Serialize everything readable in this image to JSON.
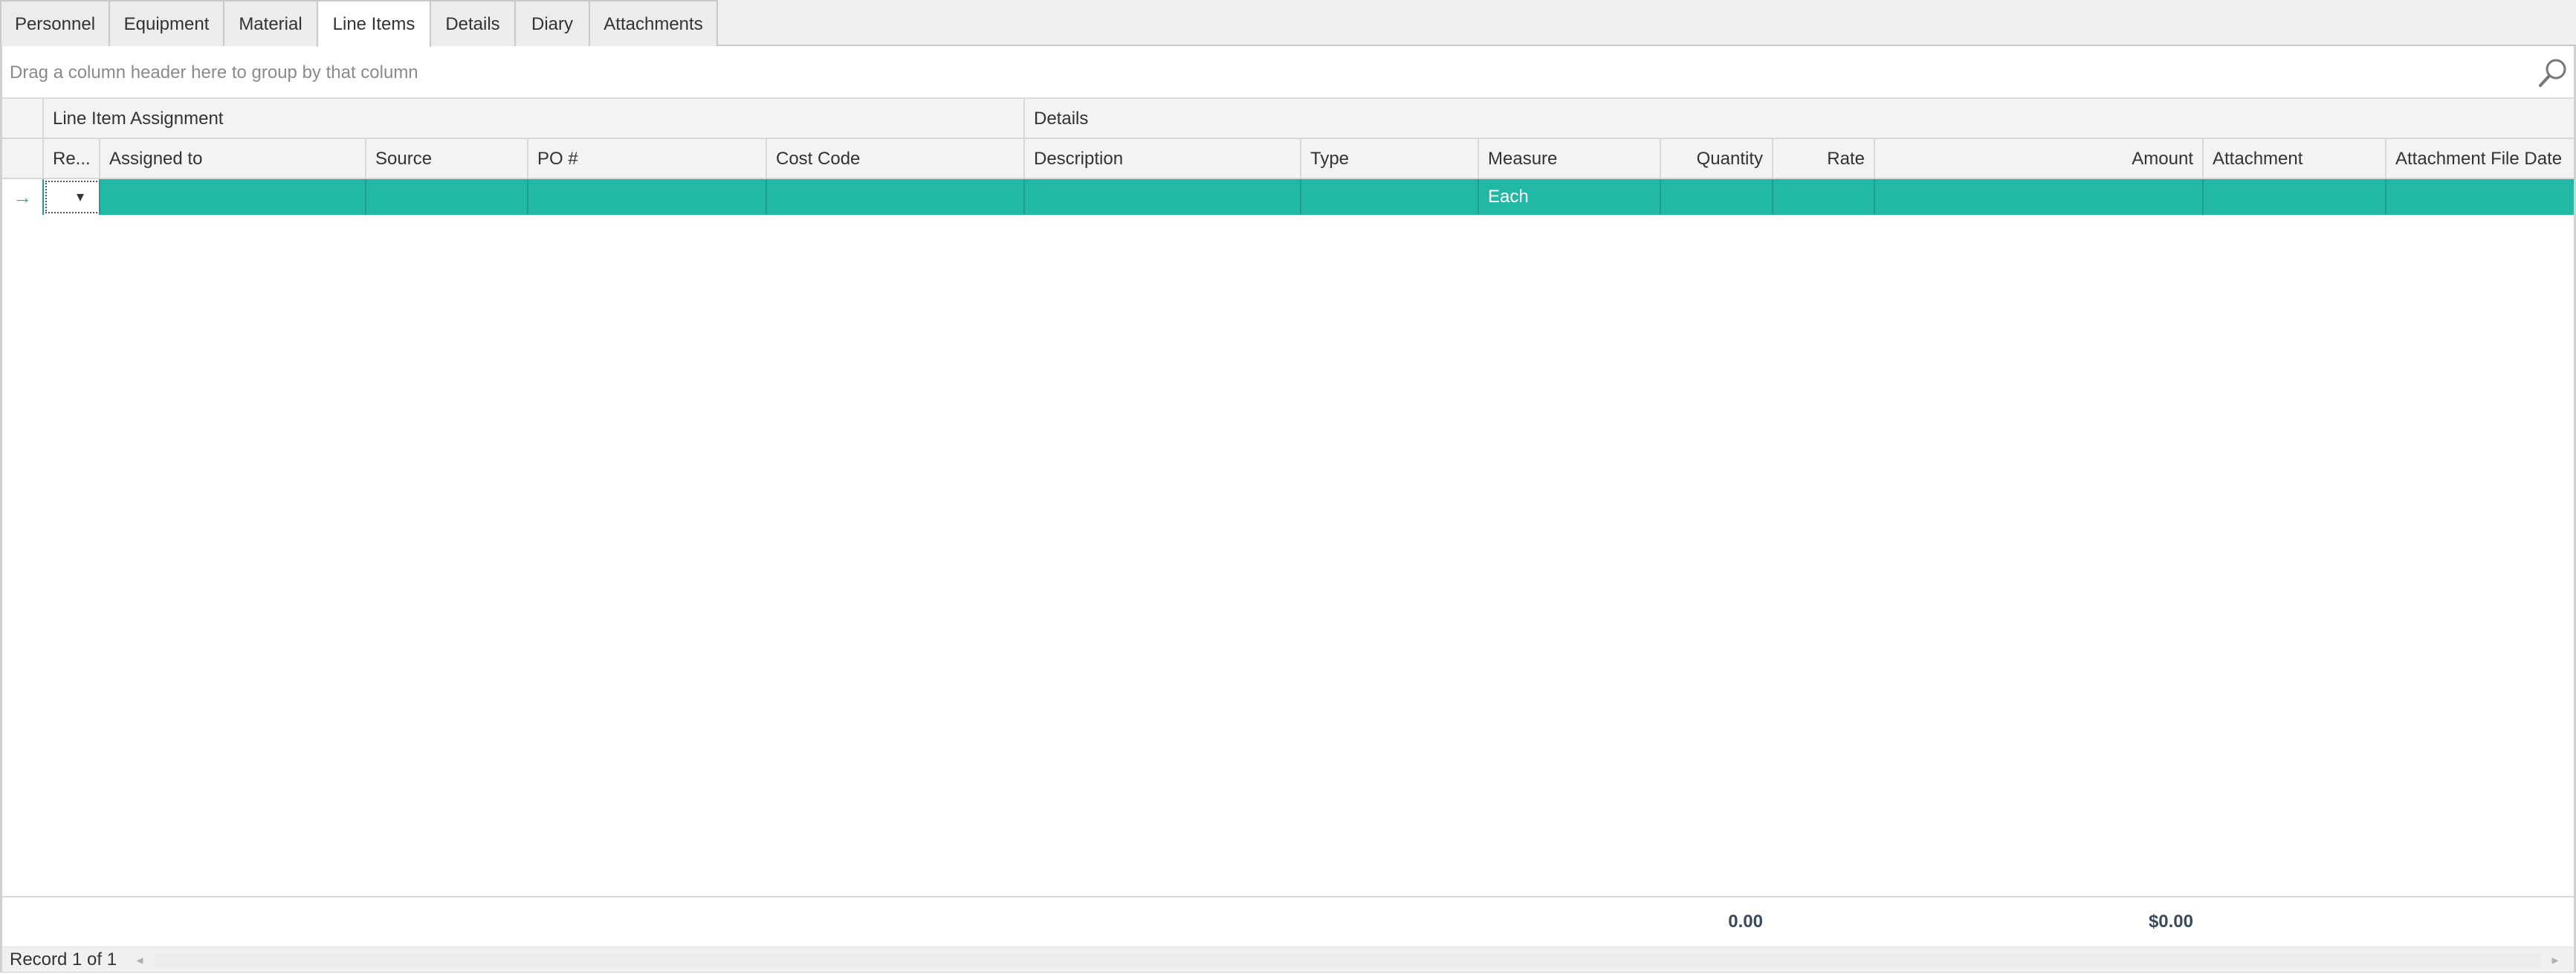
{
  "tabs": [
    "Personnel",
    "Equipment",
    "Material",
    "Line Items",
    "Details",
    "Diary",
    "Attachments"
  ],
  "active_tab": "Line Items",
  "group_panel": {
    "hint": "Drag a column header here to group by that column"
  },
  "bands": {
    "assignment": "Line Item Assignment",
    "details": "Details"
  },
  "columns": {
    "re": "Re...",
    "assigned_to": "Assigned to",
    "source": "Source",
    "po": "PO #",
    "cost_code": "Cost Code",
    "description": "Description",
    "type": "Type",
    "measure": "Measure",
    "quantity": "Quantity",
    "rate": "Rate",
    "amount": "Amount",
    "attachment": "Attachment",
    "attachment_file_date": "Attachment File Date"
  },
  "row": {
    "measure": "Each",
    "indicator": "→",
    "dropdown": "▾"
  },
  "footer": {
    "quantity_total": "0.00",
    "amount_total": "$0.00"
  },
  "navigator": {
    "record_text": "Record 1 of 1",
    "left_arrow": "◂",
    "right_arrow": "▸"
  },
  "colors": {
    "selected_row": "#22b8a6",
    "indicator": "#22b8a6"
  }
}
